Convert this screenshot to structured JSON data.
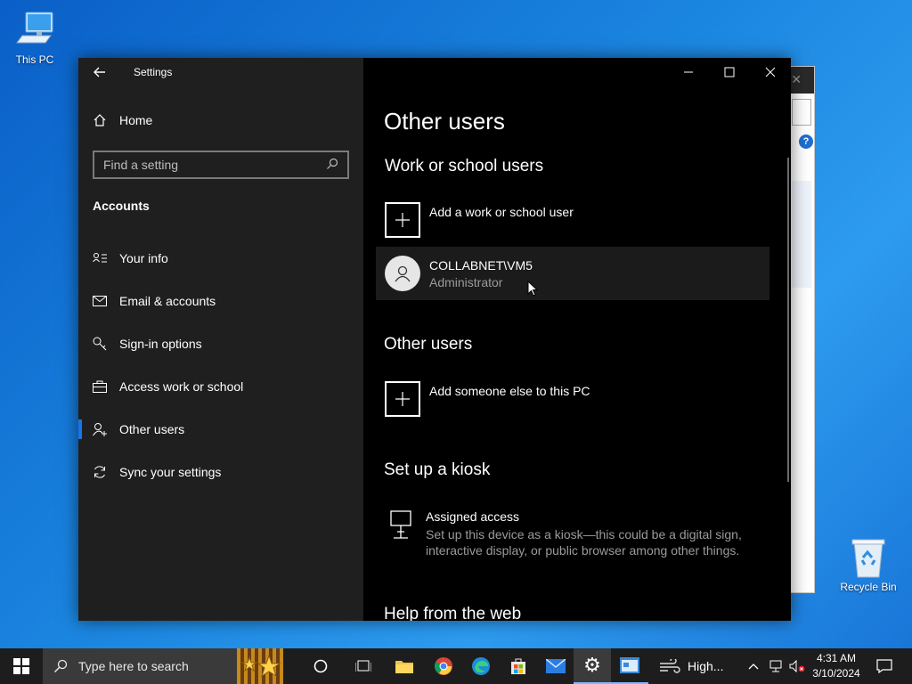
{
  "desktop": {
    "this_pc_label": "This PC",
    "recycle_bin_label": "Recycle Bin"
  },
  "settings": {
    "title": "Settings",
    "home_label": "Home",
    "search_placeholder": "Find a setting",
    "section_label": "Accounts",
    "nav": [
      {
        "label": "Your info",
        "icon": "person-card-icon"
      },
      {
        "label": "Email & accounts",
        "icon": "mail-icon"
      },
      {
        "label": "Sign-in options",
        "icon": "key-icon"
      },
      {
        "label": "Access work or school",
        "icon": "briefcase-icon"
      },
      {
        "label": "Other users",
        "icon": "person-add-icon",
        "active": true
      },
      {
        "label": "Sync your settings",
        "icon": "sync-icon"
      }
    ],
    "main": {
      "page_title": "Other users",
      "work_heading": "Work or school users",
      "add_work_label": "Add a work or school user",
      "user_name": "COLLABNET\\VM5",
      "user_role": "Administrator",
      "other_heading": "Other users",
      "add_other_label": "Add someone else to this PC",
      "kiosk_heading": "Set up a kiosk",
      "kiosk_title": "Assigned access",
      "kiosk_desc_1": "Set up this device as a kiosk—this could be a digital sign,",
      "kiosk_desc_2": "interactive display, or public browser among other things.",
      "help_heading": "Help from the web"
    }
  },
  "taskbar": {
    "search_placeholder": "Type here to search",
    "weather_text": "High...",
    "time": "4:31 AM",
    "date": "3/10/2024"
  },
  "colors": {
    "accent": "#1a73e8",
    "sidebar_bg": "#1f1f1f",
    "main_bg": "#000000"
  }
}
